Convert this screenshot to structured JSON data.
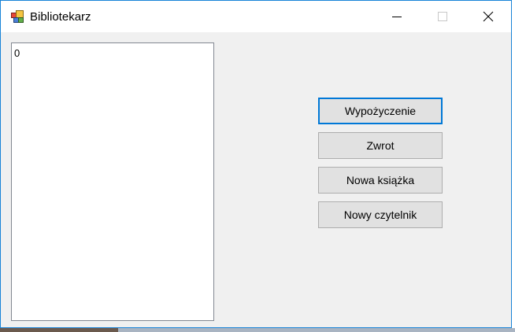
{
  "window": {
    "title": "Bibliotekarz",
    "icon": "winforms-app-icon",
    "caption_buttons": [
      "minimize-icon",
      "maximize-icon",
      "close-icon"
    ]
  },
  "listbox": {
    "items": [
      "0"
    ]
  },
  "buttons": {
    "loan": "Wypożyczenie",
    "return": "Zwrot",
    "new_book": "Nowa książka",
    "new_reader": "Nowy czytelnik"
  },
  "colors": {
    "window_border": "#1883d7",
    "focus_border": "#0078d7",
    "button_face": "#e1e1e1",
    "form_background": "#f0f0f0"
  }
}
